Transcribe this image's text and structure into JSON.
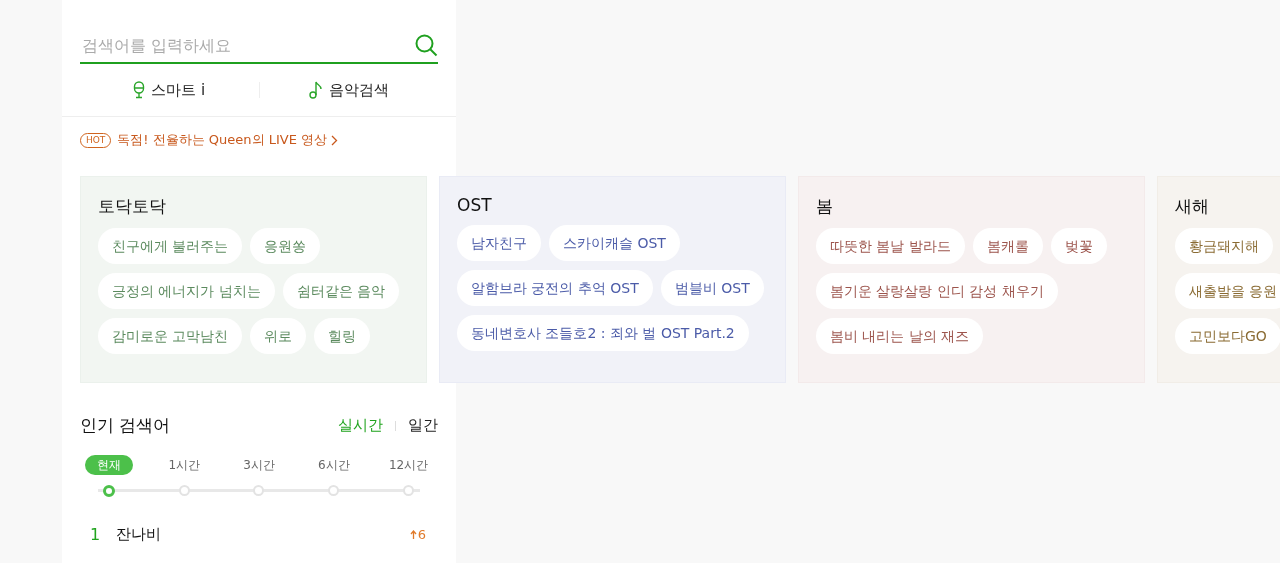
{
  "search": {
    "placeholder": "검색어를 입력하세요"
  },
  "modes": [
    {
      "kind": "mic",
      "label": "스마트 i"
    },
    {
      "kind": "note",
      "label": "음악검색"
    }
  ],
  "hot": {
    "badge": "HOT",
    "text": "독점! 전율하는 Queen의 LIVE 영상"
  },
  "themes": [
    {
      "title": "토닥토닥",
      "color": "#5b8a5e",
      "tag_rows": [
        [
          "친구에게 불러주는",
          "응원쏭"
        ],
        [
          "긍정의 에너지가 넘치는",
          "쉼터같은 음악"
        ],
        [
          "감미로운 고막남친",
          "위로",
          "힐링"
        ]
      ]
    },
    {
      "title": "OST",
      "color": "#4b5ba8",
      "tag_rows": [
        [
          "남자친구",
          "스카이캐슬 OST"
        ],
        [
          "알함브라 궁전의 추억 OST",
          "범블비 OST"
        ],
        [
          "동네변호사 조들호2 : 죄와 벌 OST Part.2"
        ]
      ]
    },
    {
      "title": "봄",
      "color": "#9c544c",
      "tag_rows": [
        [
          "따뜻한 봄날 발라드",
          "봄캐롤",
          "벚꽃"
        ],
        [
          "봄기운 살랑살랑 인디 감성 채우기"
        ],
        [
          "봄비 내리는 날의 재즈"
        ]
      ]
    },
    {
      "title": "새해",
      "color": "#8a6b33",
      "tag_rows": [
        [
          "황금돼지해"
        ],
        [
          "새출발을 응원"
        ],
        [
          "고민보다GO"
        ]
      ]
    }
  ],
  "popular": {
    "title": "인기 검색어",
    "tabs": [
      {
        "label": "실시간",
        "selected": true
      },
      {
        "label": "일간",
        "selected": false
      }
    ],
    "times": [
      {
        "label": "현재",
        "selected": true
      },
      {
        "label": "1시간",
        "selected": false
      },
      {
        "label": "3시간",
        "selected": false
      },
      {
        "label": "6시간",
        "selected": false
      },
      {
        "label": "12시간",
        "selected": false
      }
    ],
    "rows": [
      {
        "rank": "1",
        "title": "잔나비",
        "change": "6"
      }
    ]
  }
}
